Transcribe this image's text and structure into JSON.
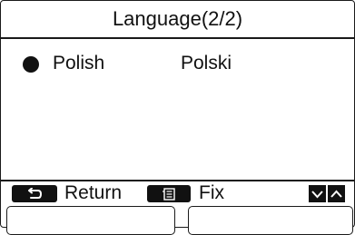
{
  "header": {
    "title": "Language(2/2)"
  },
  "languages": [
    {
      "name": "Polish",
      "native": "Polski",
      "selected": true
    }
  ],
  "footer": {
    "return_label": "Return",
    "fix_label": "Fix",
    "return_icon": "return-arrow-icon",
    "menu_icon": "menu-icon",
    "down_icon": "chevron-down-icon",
    "up_icon": "chevron-up-icon"
  },
  "colors": {
    "foreground": "#111111",
    "background": "#ffffff"
  }
}
